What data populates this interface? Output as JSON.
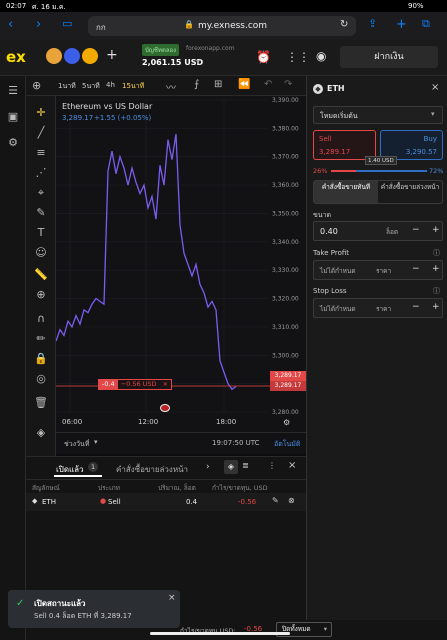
{
  "status_bar": {
    "time": "02:07",
    "date": "ศ. 16 ม.ค.",
    "battery": "90%"
  },
  "browser": {
    "tab_label": "กก",
    "url": "my.exness.com"
  },
  "header": {
    "account_tag": "บัญชีทดลอง",
    "account_site": "forexonapp.com",
    "balance": "2,061.15 USD",
    "deposit_label": "ฝากเงิน"
  },
  "chart_toolbar": {
    "timeframes": [
      "1นาที",
      "5นาที",
      "4h",
      "15นาที"
    ],
    "active_timeframe": "15นาที"
  },
  "chart": {
    "title": "Ethereum vs US Dollar",
    "price_line": "3,289.17",
    "change": "+1.55 (+0.05%)",
    "order_qty": "-0.4",
    "order_pl": "−0.56 USD",
    "current_price_tag1": "3,289.17",
    "current_price_tag2": "3,289.17",
    "time_labels": [
      "06:00",
      "12:00",
      "18:00",
      "21"
    ],
    "range_label": "ช่วงวันที่",
    "clock": "19:07:50 UTC",
    "auto_label": "อัตโนมัติ"
  },
  "chart_data": {
    "type": "line",
    "title": "Ethereum vs US Dollar",
    "ylim": [
      3280,
      3390
    ],
    "y_ticks": [
      "3,390.00",
      "3,380.00",
      "3,370.00",
      "3,360.00",
      "3,350.00",
      "3,340.00",
      "3,330.00",
      "3,320.00",
      "3,310.00",
      "3,300.00",
      "3,290.00",
      "3,280.00"
    ],
    "x_ticks": [
      "06:00",
      "12:00",
      "18:00"
    ],
    "series": [
      {
        "values": [
          3305,
          3309,
          3307,
          3312,
          3310,
          3314,
          3311,
          3316,
          3315,
          3318,
          3320,
          3319,
          3318,
          3365,
          3372,
          3364,
          3370,
          3366,
          3360,
          3366,
          3361,
          3357,
          3360,
          3352,
          3356,
          3348,
          3367,
          3360,
          3376,
          3369,
          3378,
          3346,
          3336,
          3332,
          3328,
          3332,
          3325,
          3322,
          3317,
          3319,
          3316,
          3298,
          3294,
          3290,
          3288,
          3289
        ]
      }
    ]
  },
  "right_panel": {
    "symbol": "ETH",
    "mode": "โหมดเริ่มต้น",
    "sell_label": "Sell",
    "sell_price": "3,289.17",
    "buy_label": "Buy",
    "buy_price": "3,290.57",
    "spread": "1.40 USD",
    "sentiment_sell": "26%",
    "sentiment_buy": "72%",
    "tab_market": "คำสั่งซื้อขายทันที",
    "tab_pending": "คำสั่งซื้อขายล่วงหน้า",
    "size_label": "ขนาด",
    "size_value": "0.40",
    "size_unit": "ล็อต",
    "tp_label": "Take Profit",
    "tp_value": "ไม่ได้กำหนด",
    "tp_unit": "ราคา",
    "sl_label": "Stop Loss",
    "sl_value": "ไม่ได้กำหนด",
    "sl_unit": "ราคา"
  },
  "positions": {
    "tab_open": "เปิดแล้ว",
    "open_count": "1",
    "tab_pending": "คำสั่งซื้อขายล่วงหน้า",
    "col_symbol": "สัญลักษณ์",
    "col_type": "ประเภท",
    "col_volume": "ปริมาณ, ล็อต",
    "col_pl": "กำไร/ขาดทุน, USD",
    "rows": [
      {
        "symbol": "ETH",
        "type": "Sell",
        "volume": "0.4",
        "pl": "-0.56"
      }
    ]
  },
  "toast": {
    "title": "เปิดสถานะแล้ว",
    "body": "Sell 0.4 ล็อต ETH ที่ 3,289.17"
  },
  "footer": {
    "pl_label": "กำไร/ขาดทุน USD:",
    "pl_value": "-0.56",
    "close_all": "ปิดทั้งหมด"
  }
}
